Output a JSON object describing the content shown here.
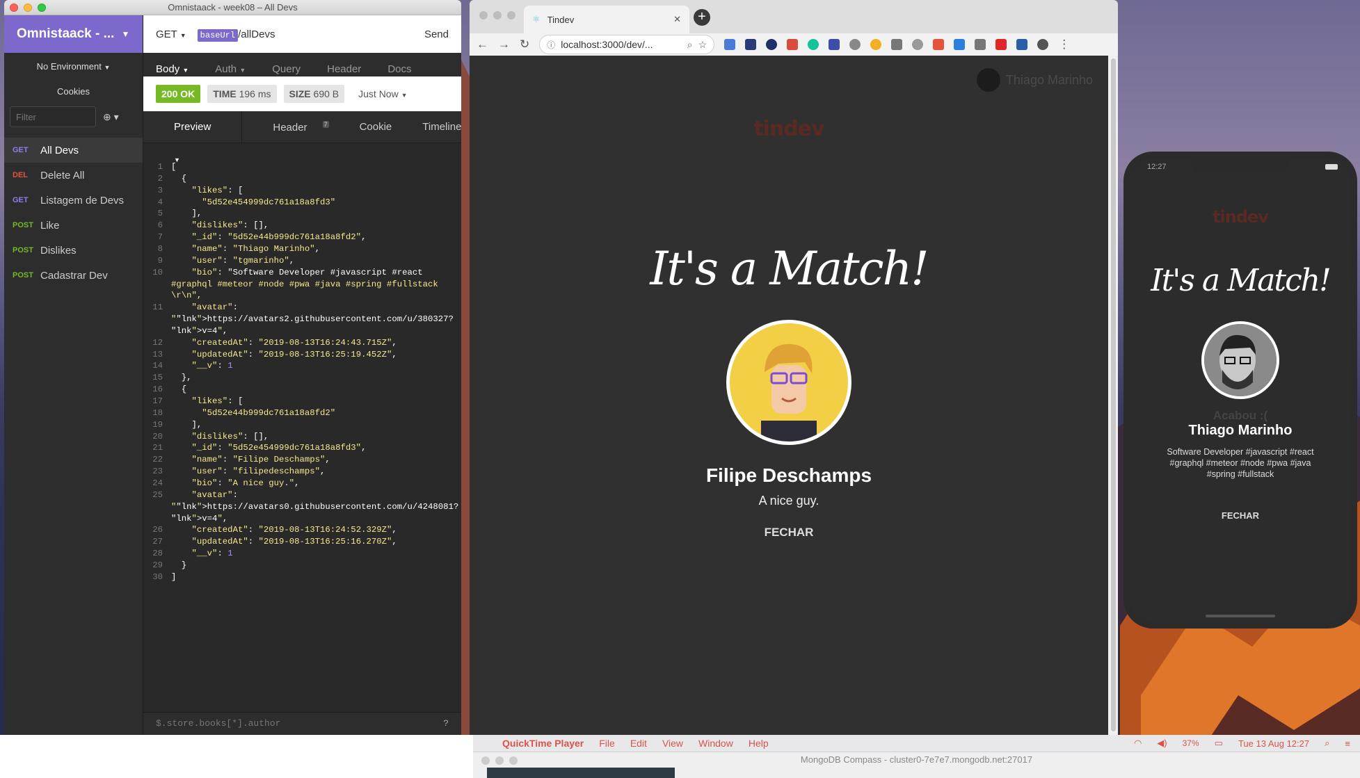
{
  "insomnia": {
    "window_title": "Omnistaack - week08 – All Devs",
    "workspace": "Omnistaack - ...",
    "environment": "No Environment",
    "cookies": "Cookies",
    "filter_placeholder": "Filter",
    "requests": [
      {
        "method": "GET",
        "name": "All Devs"
      },
      {
        "method": "DEL",
        "name": "Delete All"
      },
      {
        "method": "GET",
        "name": "Listagem de Devs"
      },
      {
        "method": "POST",
        "name": "Like"
      },
      {
        "method": "POST",
        "name": "Dislikes"
      },
      {
        "method": "POST",
        "name": "Cadastrar Dev"
      }
    ],
    "url": {
      "method": "GET",
      "base": "baseUrl",
      "path": "/allDevs",
      "send": "Send"
    },
    "request_tabs": [
      "Body",
      "Auth",
      "Query",
      "Header",
      "Docs"
    ],
    "response": {
      "status": "200 OK",
      "time_label": "TIME",
      "time": "196 ms",
      "size_label": "SIZE",
      "size": "690 B",
      "when": "Just Now"
    },
    "response_tabs": {
      "preview": "Preview",
      "header": "Header",
      "header_count": "7",
      "cookie": "Cookie",
      "timeline": "Timeline"
    },
    "json_path_placeholder": "$.store.books[*].author",
    "code_lines": [
      "[",
      "  {",
      "    \"likes\": [",
      "      \"5d52e454999dc761a18a8fd3\"",
      "    ],",
      "    \"dislikes\": [],",
      "    \"_id\": \"5d52e44b999dc761a18a8fd2\",",
      "    \"name\": \"Thiago Marinho\",",
      "    \"user\": \"tgmarinho\",",
      "    \"bio\": \"Software Developer #javascript #react",
      "#graphql #meteor #node #pwa #java #spring #fullstack",
      "\\r\\n\",",
      "    \"avatar\":",
      "\"https://avatars2.githubusercontent.com/u/380327?",
      "v=4\",",
      "    \"createdAt\": \"2019-08-13T16:24:43.715Z\",",
      "    \"updatedAt\": \"2019-08-13T16:25:19.452Z\",",
      "    \"__v\": 1",
      "  },",
      "  {",
      "    \"likes\": [",
      "      \"5d52e44b999dc761a18a8fd2\"",
      "    ],",
      "    \"dislikes\": [],",
      "    \"_id\": \"5d52e454999dc761a18a8fd3\",",
      "    \"name\": \"Filipe Deschamps\",",
      "    \"user\": \"filipedeschamps\",",
      "    \"bio\": \"A nice guy.\",",
      "    \"avatar\":",
      "\"https://avatars0.githubusercontent.com/u/4248081?",
      "v=4\",",
      "    \"createdAt\": \"2019-08-13T16:24:52.329Z\",",
      "    \"updatedAt\": \"2019-08-13T16:25:16.270Z\",",
      "    \"__v\": 1",
      "  }",
      "]"
    ],
    "line_numbers": [
      "1",
      "2",
      "3",
      "4",
      "5",
      "6",
      "7",
      "8",
      "9",
      "10",
      "",
      "",
      "11",
      "",
      "",
      "12",
      "13",
      "14",
      "15",
      "16",
      "17",
      "18",
      "19",
      "20",
      "21",
      "22",
      "23",
      "24",
      "25",
      "",
      "",
      "26",
      "27",
      "28",
      "29",
      "30"
    ]
  },
  "chrome": {
    "tab_title": "Tindev",
    "url": "localhost:3000/dev/...",
    "user_name": "Thiago Marinho",
    "logo": "tindev",
    "match_title": "It's a Match!",
    "match_name": "Filipe Deschamps",
    "match_bio": "A nice guy.",
    "close_button": "FECHAR"
  },
  "phone": {
    "time": "12:27",
    "logo": "tindev",
    "match_title": "It's a Match!",
    "behind_text": "Acabou :(",
    "match_name": "Thiago Marinho",
    "match_bio": "Software Developer #javascript #react #graphql #meteor #node #pwa #java #spring #fullstack",
    "close_button": "FECHAR"
  },
  "menubar": {
    "app": "QuickTime Player",
    "items": [
      "File",
      "Edit",
      "View",
      "Window",
      "Help"
    ],
    "battery": "37%",
    "datetime": "Tue 13 Aug  12:27"
  },
  "compass": {
    "title": "MongoDB Compass - cluster0-7e7e7.mongodb.net:27017"
  },
  "colors": {
    "insomnia_purple": "#7d69cb",
    "tindev_red": "#df4723",
    "ok_green": "#75ba24"
  }
}
